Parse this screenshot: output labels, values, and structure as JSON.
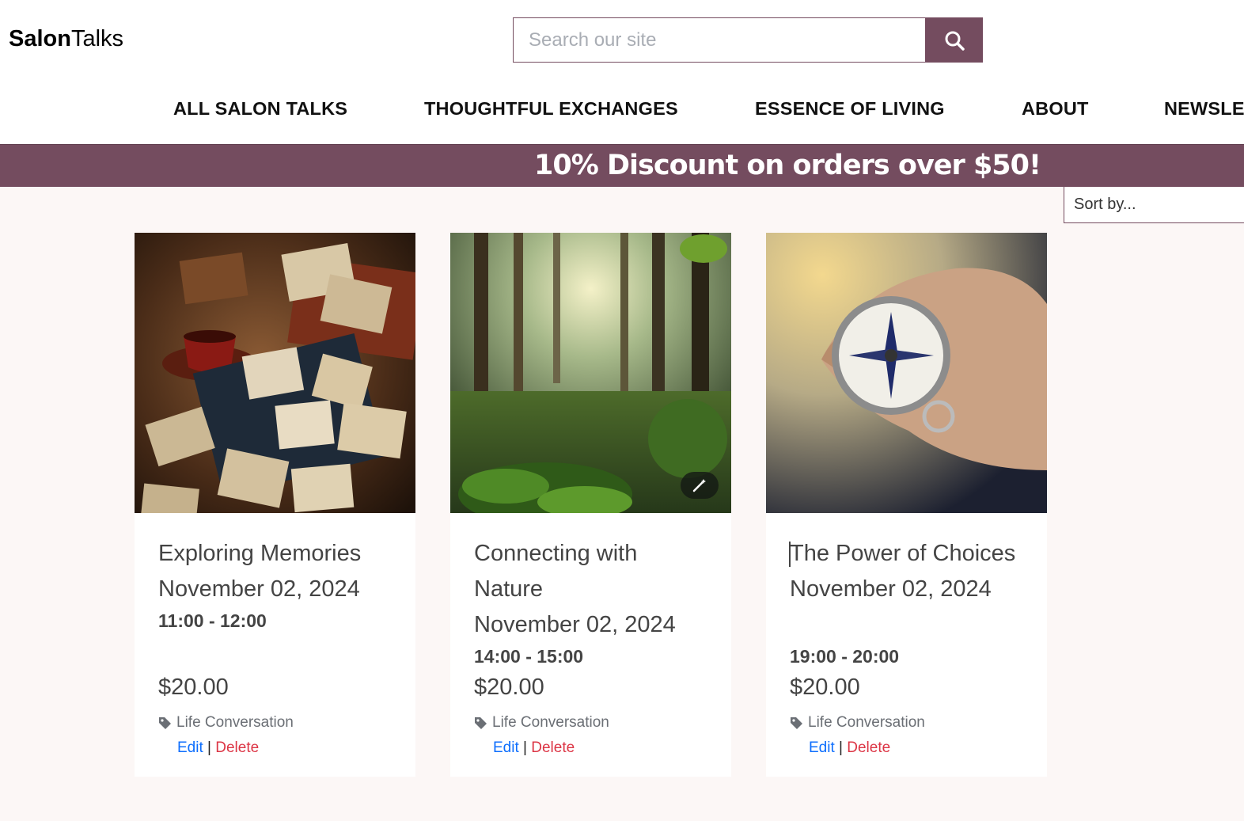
{
  "brand": {
    "bold": "Salon",
    "light": "Talks"
  },
  "search": {
    "placeholder": "Search our site"
  },
  "nav": [
    {
      "label": "ALL SALON TALKS"
    },
    {
      "label": "THOUGHTFUL EXCHANGES"
    },
    {
      "label": "ESSENCE OF LIVING"
    },
    {
      "label": "ABOUT"
    },
    {
      "label": "NEWSLE"
    }
  ],
  "banner": {
    "text": "10% Discount on orders over $50!"
  },
  "sort": {
    "label": "Sort by..."
  },
  "cards": [
    {
      "title": "Exploring Memories",
      "date": "November 02, 2024",
      "time": "11:00 - 12:00",
      "price": "$20.00",
      "tag": "Life Conversation",
      "edit": "Edit",
      "sep": "|",
      "delete": "Delete"
    },
    {
      "title": "Connecting with Nature",
      "date": "November 02, 2024",
      "time": "14:00 - 15:00",
      "price": "$20.00",
      "tag": "Life Conversation",
      "edit": "Edit",
      "sep": "|",
      "delete": "Delete"
    },
    {
      "title": "The Power of Choices",
      "date": "November 02, 2024",
      "time": "19:00 - 20:00",
      "price": "$20.00",
      "tag": "Life Conversation",
      "edit": "Edit",
      "sep": "|",
      "delete": "Delete"
    }
  ],
  "colors": {
    "accent": "#744c5f",
    "page_bg": "#fcf7f6",
    "edit": "#0d6efd",
    "delete": "#dc3545"
  },
  "icons": {
    "search": "search-icon",
    "tag": "tag-icon",
    "wand": "magic-wand-icon"
  }
}
